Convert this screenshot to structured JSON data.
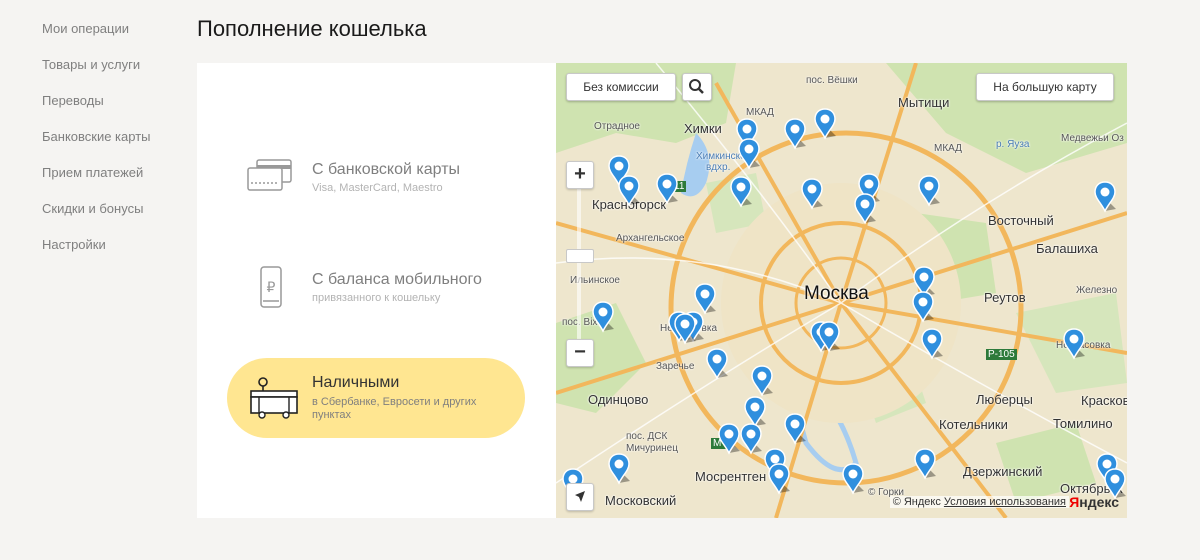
{
  "sidebar": {
    "items": [
      {
        "label": "Мои операции"
      },
      {
        "label": "Товары и услуги"
      },
      {
        "label": "Переводы"
      },
      {
        "label": "Банковские карты"
      },
      {
        "label": "Прием платежей"
      },
      {
        "label": "Скидки и бонусы"
      },
      {
        "label": "Настройки"
      }
    ]
  },
  "page": {
    "title": "Пополнение кошелька"
  },
  "methods": [
    {
      "title": "С банковской карты",
      "subtitle": "Visa, MasterCard, Maestro",
      "icon": "bank-card-icon",
      "active": false
    },
    {
      "title": "С баланса мобильного",
      "subtitle": "привязанного к кошельку",
      "icon": "mobile-phone-icon",
      "active": false
    },
    {
      "title": "Наличными",
      "subtitle_line1": "в Сбербанке, Евросети и других",
      "subtitle_line2": "пунктах",
      "icon": "terminal-icon",
      "active": true
    }
  ],
  "map": {
    "commission_button": "Без комиссии",
    "big_map_button": "На большую карту",
    "zoom_in": "+",
    "zoom_out": "−",
    "copyright": "© Яндекс",
    "terms_link": "Условия использования",
    "logo_letter": "Я",
    "logo_rest": "ндекс",
    "marker_color": "#2f8fde",
    "labels": {
      "moscow": "Москва",
      "khimki": "Химки",
      "mytishchi": "Мытищи",
      "krasnogorsk": "Красногорск",
      "vostochny": "Восточный",
      "balashikha": "Балашиха",
      "reutov": "Реутов",
      "odintsovo": "Одинцово",
      "lyubertsy": "Люберцы",
      "kotelniki": "Котельники",
      "tomilino": "Томилино",
      "dzerzhinsky": "Дзержинский",
      "moskovsky": "Московский",
      "mosrentgen": "Мосрентген",
      "zarechye": "Заречье",
      "nekrasovka": "Некрасовка",
      "oktyabrsky": "Октябрьск",
      "otradnoe": "Отрадное",
      "arkhangelskoe": "Архангельское",
      "ilyinskoe": "Ильинское",
      "veshki": "пос. Вёшки",
      "medvezhi": "Медвежьи Оз",
      "yauza": "р. Яуза",
      "khimki_reservoir_1": "Химкинское",
      "khimki_reservoir_2": "вдхр.",
      "mkad1": "МКАД",
      "mkad2": "МКАД",
      "dsk": "пос. ДСК",
      "michurinets": "Мичуринец",
      "krasko": "Красков",
      "zhelezno": "Железно",
      "road_m3": "М-3",
      "road_p105": "Р-105",
      "road_11": "11",
      "nemchinovka": "Немчиновка",
      "pos_vikha": "пос. Вiха",
      "gorki": "© Горки"
    }
  }
}
